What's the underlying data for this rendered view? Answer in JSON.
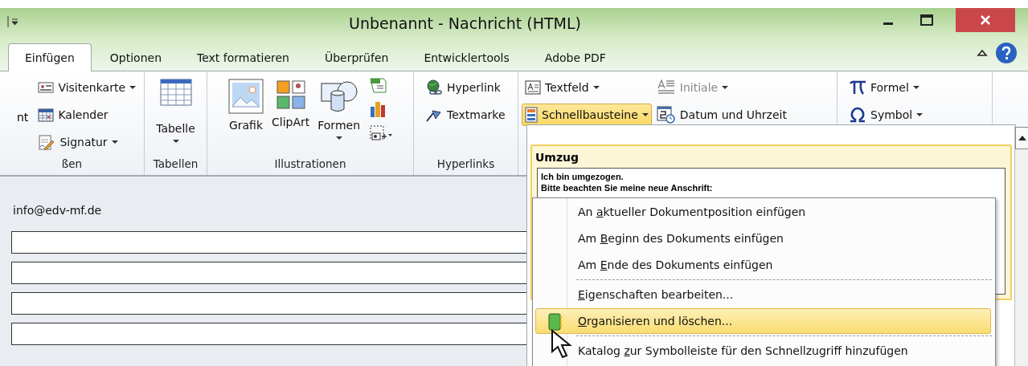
{
  "window": {
    "title": "Unbenannt - Nachricht (HTML)"
  },
  "tabs": [
    {
      "label": "Einfügen",
      "selected": true
    },
    {
      "label": "Optionen",
      "selected": false
    },
    {
      "label": "Text formatieren",
      "selected": false
    },
    {
      "label": "Überprüfen",
      "selected": false
    },
    {
      "label": "Entwicklertools",
      "selected": false
    },
    {
      "label": "Adobe PDF",
      "selected": false
    }
  ],
  "ribbon_groups": [
    {
      "kind": "small",
      "label": "ßen",
      "cut_text": "nt",
      "items": [
        {
          "label": "Visitenkarte",
          "dropdown": true
        },
        {
          "label": "Kalender",
          "dropdown": false
        },
        {
          "label": "Signatur",
          "dropdown": true
        }
      ]
    },
    {
      "kind": "large",
      "label": "Tabellen",
      "items": [
        {
          "label": "Tabelle",
          "dropdown": true
        }
      ]
    },
    {
      "kind": "large",
      "label": "Illustrationen",
      "items": [
        {
          "label": "Grafik",
          "dropdown": false
        },
        {
          "label": "ClipArt",
          "dropdown": false
        },
        {
          "label": "Formen",
          "dropdown": true
        }
      ]
    },
    {
      "kind": "small",
      "label": "Hyperlinks",
      "items": [
        {
          "label": "Hyperlink",
          "dropdown": false
        },
        {
          "label": "Textmarke",
          "dropdown": false
        }
      ]
    },
    {
      "kind": "text",
      "items": [
        {
          "label": "Textfeld",
          "dropdown": true,
          "highlighted": false,
          "disabled": false
        },
        {
          "label": "Schnellbausteine",
          "dropdown": true,
          "highlighted": true,
          "disabled": false
        },
        {
          "label": "Initiale",
          "dropdown": true,
          "highlighted": false,
          "disabled": true
        },
        {
          "label": "Datum und Uhrzeit",
          "dropdown": false,
          "highlighted": false,
          "disabled": false
        }
      ]
    },
    {
      "kind": "symbols",
      "items": [
        {
          "label": "Formel",
          "dropdown": true
        },
        {
          "label": "Symbol",
          "dropdown": true
        }
      ]
    }
  ],
  "message": {
    "from": "info@edv-mf.de",
    "fields": [
      {
        "kind": "line"
      },
      {
        "kind": "line"
      },
      {
        "kind": "line"
      },
      {
        "kind": "line"
      }
    ]
  },
  "gallery": {
    "heading": "Umzug",
    "preview": [
      "Ich bin umgezogen.",
      "Bitte beachten Sie meine neue Anschrift:"
    ]
  },
  "menu": [
    {
      "before": "An ",
      "key": "a",
      "after": "ktueller Dokumentposition einfügen",
      "selected": false,
      "separator_before": false
    },
    {
      "before": "Am ",
      "key": "B",
      "after": "eginn des Dokuments einfügen",
      "selected": false,
      "separator_before": false
    },
    {
      "before": "Am ",
      "key": "E",
      "after": "nde des Dokuments einfügen",
      "selected": false,
      "separator_before": false
    },
    {
      "key": "E",
      "after": "igenschaften bearbeiten...",
      "selected": false,
      "separator_before": true
    },
    {
      "key": "O",
      "after": "rganisieren und löschen...",
      "selected": true,
      "separator_before": false
    },
    {
      "before": "Katalog ",
      "key": "z",
      "after": "ur Symbolleiste für den Schnellzugriff hinzufügen",
      "selected": false,
      "separator_before": true
    }
  ]
}
